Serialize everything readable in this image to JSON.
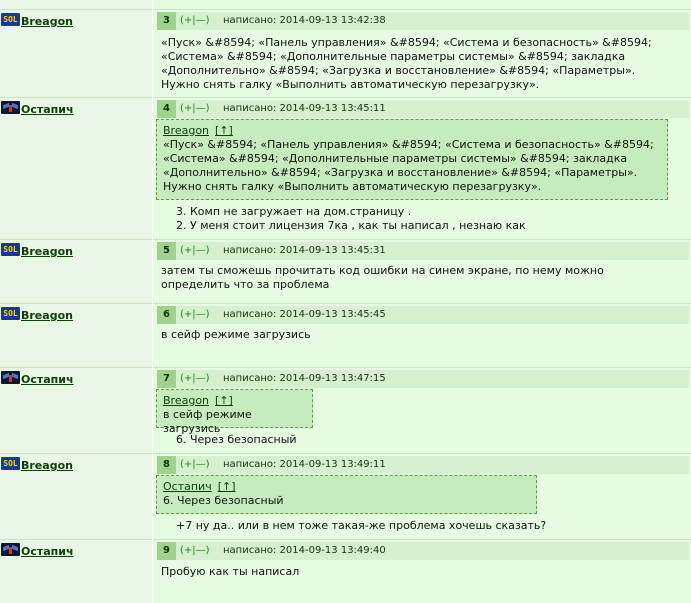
{
  "posts": [
    {
      "number": "3",
      "author": "Breagon",
      "avatar": "sol-avatar",
      "rating": "(+|—)",
      "posted": "написано: 2014-09-13 13:42:38",
      "text": "«Пуск» &#8594; «Панель управления» &#8594; «Система и безопасность» &#8594; «Система» &#8594; «Дополнительные параметры системы» &#8594; закладка «Дополнительно» &#8594; «Загрузка и восстановление» &#8594; «Параметры». Нужно снять галку «Выполнить автоматическую перезагрузку»."
    },
    {
      "number": "4",
      "author": "Остапич",
      "avatar": "ostapich-avatar",
      "rating": "(+|—)",
      "posted": "написано: 2014-09-13 13:45:11",
      "quote_author": "Breagon",
      "quote_link": "[↑]",
      "quote_text": "«Пуск» &#8594; «Панель управления» &#8594; «Система и безопасность» &#8594; «Система» &#8594; «Дополнительные параметры системы» &#8594; закладка «Дополнительно» &#8594; «Загрузка и восстановление» &#8594; «Параметры». Нужно снять галку «Выполнить автоматическую перезагрузку».",
      "reply_lines": [
        "3. Комп не загружает на дом.страницу .",
        "2. У меня стоит лицензия 7ка , как ты написал , незнаю как"
      ]
    },
    {
      "number": "5",
      "author": "Breagon",
      "avatar": "sol-avatar",
      "rating": "(+|—)",
      "posted": "написано: 2014-09-13 13:45:31",
      "text": "затем ты сможешь прочитать код ошибки на синем экране, по нему можно определить что за проблема"
    },
    {
      "number": "6",
      "author": "Breagon",
      "avatar": "sol-avatar",
      "rating": "(+|—)",
      "posted": "написано: 2014-09-13 13:45:45",
      "text": "в сейф режиме загрузись"
    },
    {
      "number": "7",
      "author": "Остапич",
      "avatar": "ostapich-avatar",
      "rating": "(+|—)",
      "posted": "написано: 2014-09-13 13:47:15",
      "quote_author": "Breagon",
      "quote_link": "[↑]",
      "quote_text": "в сейф режиме загрузись",
      "reply_lines": [
        "6. Через безопасный"
      ]
    },
    {
      "number": "8",
      "author": "Breagon",
      "avatar": "sol-avatar",
      "rating": "(+|—)",
      "posted": "написано: 2014-09-13 13:49:11",
      "quote_author": "Остапич",
      "quote_link": "[↑]",
      "quote_text": "6. Через безопасный",
      "reply_lines": [
        "+7 ну да.. или в нем тоже такая-же проблема хочешь сказать?"
      ]
    },
    {
      "number": "9",
      "author": "Остапич",
      "avatar": "ostapich-avatar",
      "rating": "(+|—)",
      "posted": "написано: 2014-09-13 13:49:40",
      "text": "Пробую как ты написал"
    }
  ],
  "avatar_badge": "SOL"
}
